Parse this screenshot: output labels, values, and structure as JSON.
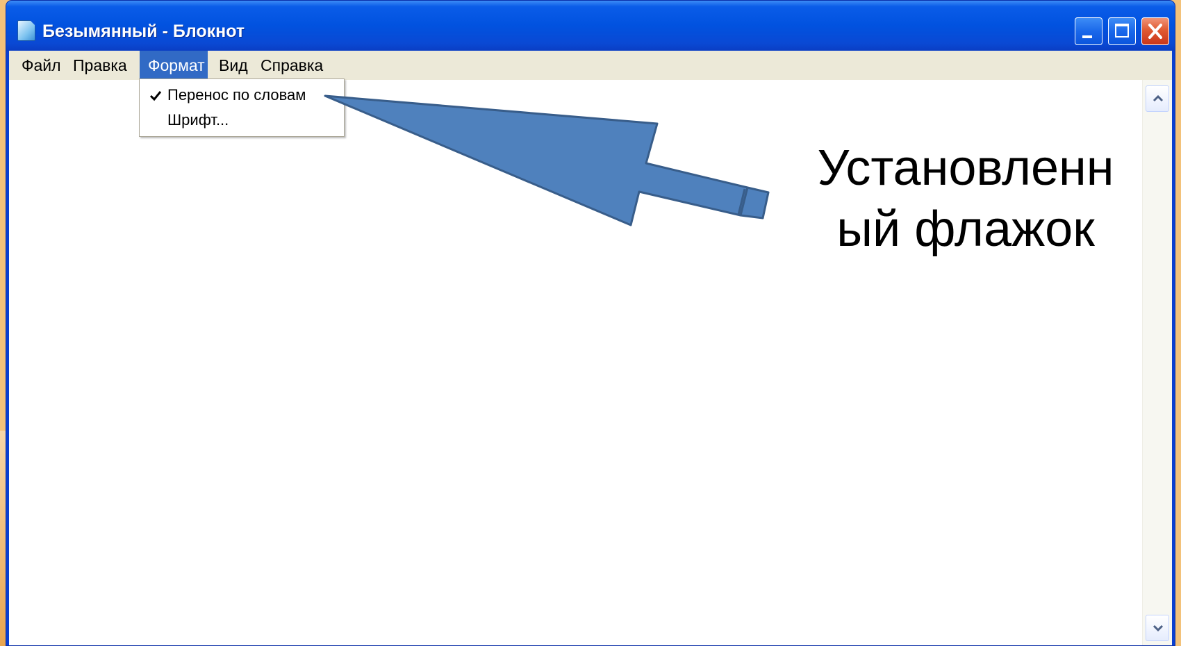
{
  "window": {
    "title": "Безымянный - Блокнот",
    "app_icon": "notepad-icon"
  },
  "menubar": {
    "items": [
      "Файл",
      "Правка",
      "Формат",
      "Вид",
      "Справка"
    ],
    "active": "Формат"
  },
  "format_menu": {
    "items": [
      {
        "label": "Перенос по словам",
        "checked": true
      },
      {
        "label": "Шрифт...",
        "checked": false
      }
    ]
  },
  "callout": {
    "line1": "Установленн",
    "line2": "ый флажок",
    "arrow_color": "#4f81bd",
    "arrow_outline": "#385d8a"
  },
  "colors": {
    "titlebar": "#0152df",
    "menu_highlight": "#316ac5",
    "close_button": "#e05a32",
    "slide_background": "#f3c27a"
  }
}
